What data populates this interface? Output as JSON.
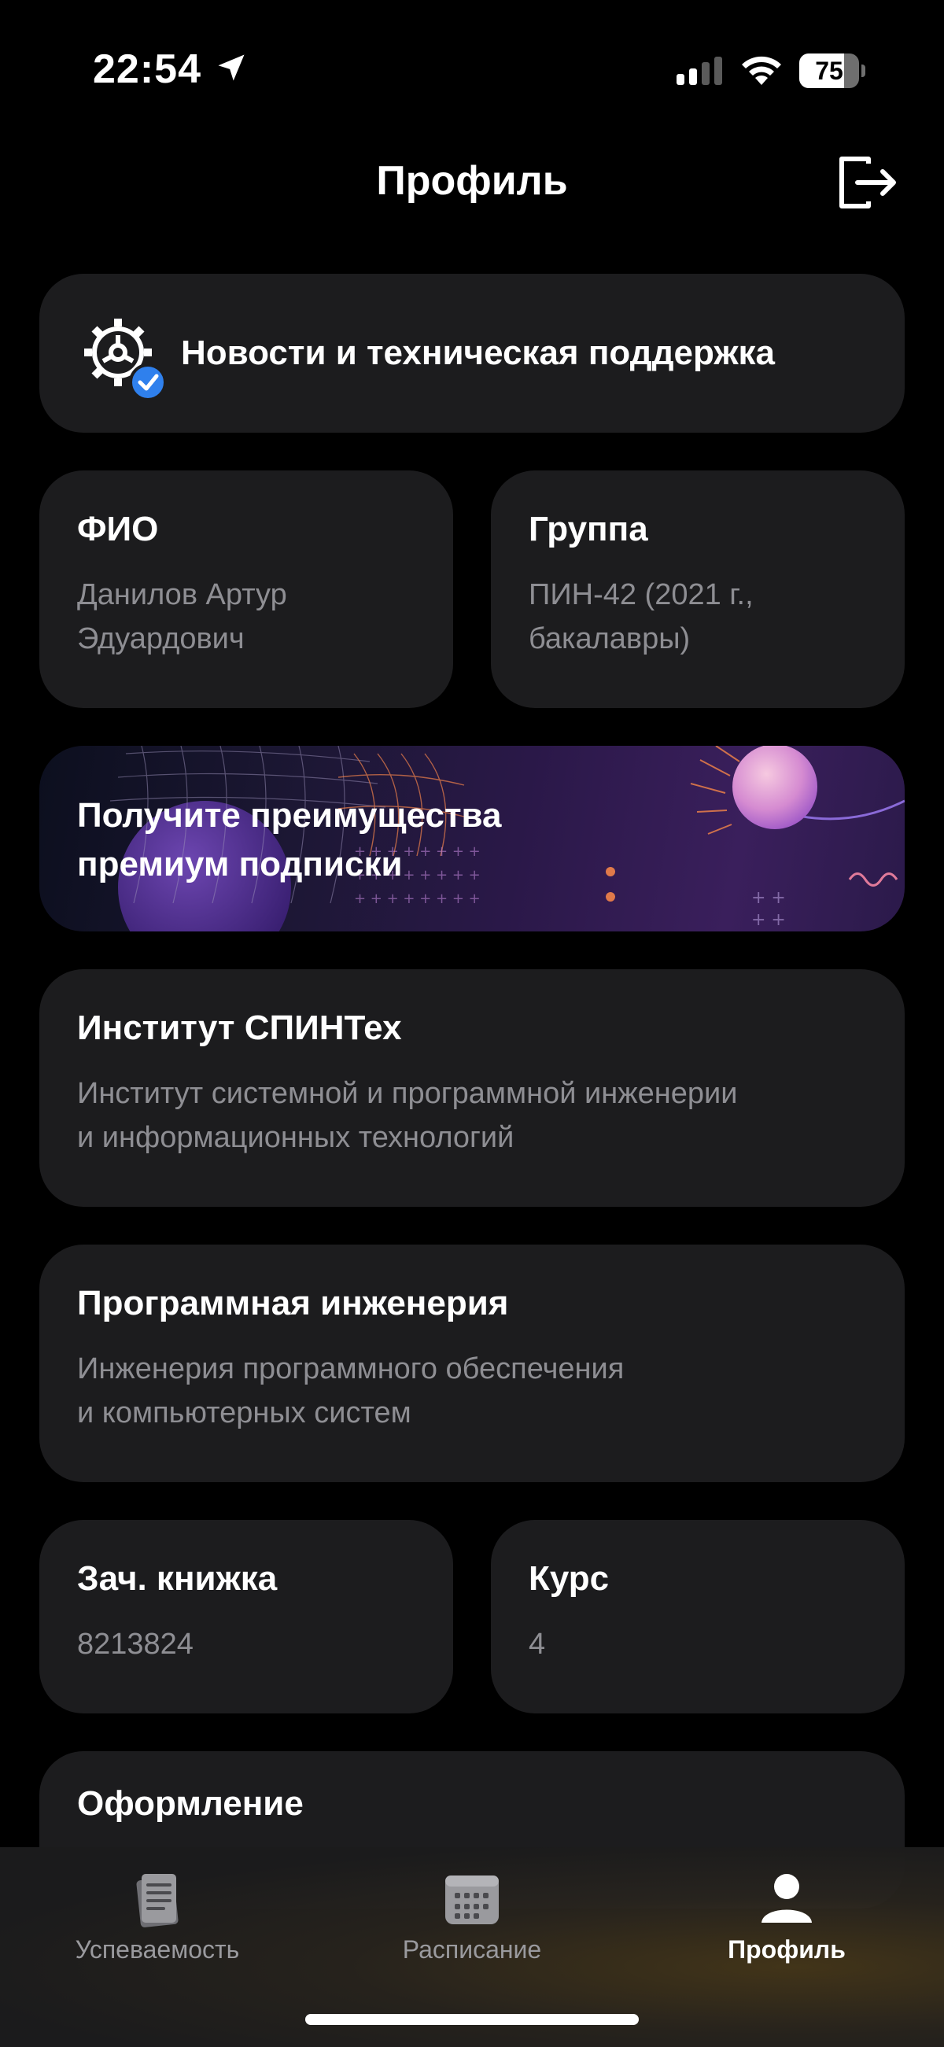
{
  "status_bar": {
    "time": "22:54",
    "battery": "75",
    "battery_level": 0.75
  },
  "header": {
    "title": "Профиль",
    "logout_icon": "logout-icon"
  },
  "news": {
    "label": "Новости и техническая поддержка",
    "icon": "gear-check-icon"
  },
  "fio": {
    "title": "ФИО",
    "value_line1": "Данилов Артур",
    "value_line2": "Эдуардович"
  },
  "group": {
    "title": "Группа",
    "value_line1": "ПИН-42 (2021 г.,",
    "value_line2": "бакалавры)"
  },
  "promo": {
    "line1": "Получите преимущества",
    "line2": "премиум подписки"
  },
  "institute": {
    "title": "Институт СПИНТех",
    "value_line1": "Институт системной и программной инженерии",
    "value_line2": "и информационных технологий"
  },
  "program": {
    "title": "Программная инженерия",
    "value_line1": "Инженерия программного обеспечения",
    "value_line2": "и компьютерных систем"
  },
  "record_book": {
    "title": "Зач. книжка",
    "value": "8213824"
  },
  "course": {
    "title": "Курс",
    "value": "4"
  },
  "appearance": {
    "title": "Оформление"
  },
  "tabs": [
    {
      "label": "Успеваемость",
      "icon": "gradebook-icon",
      "active": false
    },
    {
      "label": "Расписание",
      "icon": "calendar-icon",
      "active": false
    },
    {
      "label": "Профиль",
      "icon": "profile-icon",
      "active": true
    }
  ],
  "colors": {
    "background": "#000000",
    "card": "#1c1c1e",
    "secondary_text": "#8e8e93",
    "accent_check": "#2f80ed"
  }
}
